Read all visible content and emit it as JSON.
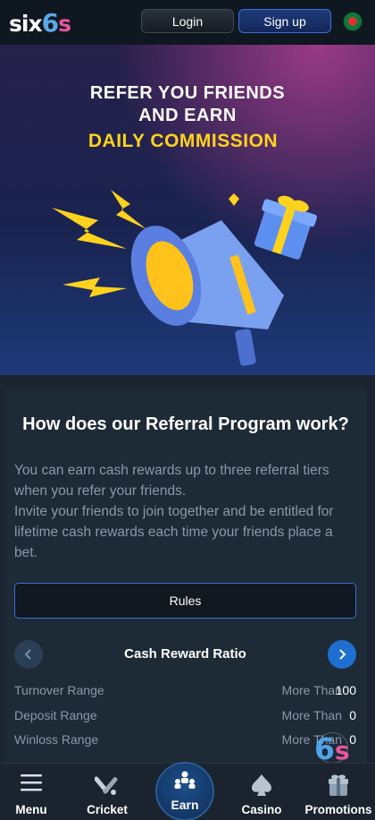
{
  "header": {
    "logo_part1": "six",
    "logo_part2": "6",
    "logo_part3": "s",
    "login_label": "Login",
    "signup_label": "Sign up",
    "flag_icon": "bangladesh-flag-icon"
  },
  "banner": {
    "line1": "REFER YOU FRIENDS",
    "line2": "AND EARN",
    "line3": "DAILY COMMISSION"
  },
  "referral": {
    "title": "How does our Referral Program work?",
    "description": "You can earn cash rewards up to three referral tiers when you refer your friends.\nInvite your friends to join together and be entitled for lifetime cash rewards each time your friends place a bet.",
    "rules_label": "Rules",
    "ratio_title": "Cash Reward Ratio",
    "rows": [
      {
        "label": "Turnover Range",
        "more_than": "More Than",
        "value": "100"
      },
      {
        "label": "Deposit Range",
        "more_than": "More Than",
        "value": "0"
      },
      {
        "label": "Winloss Range",
        "more_than": "More Than",
        "value": "0"
      }
    ]
  },
  "watermark": {
    "digit": "6",
    "letter": "s"
  },
  "nav": {
    "items": [
      {
        "label": "Menu",
        "icon": "menu-icon"
      },
      {
        "label": "Cricket",
        "icon": "cricket-icon"
      },
      {
        "label": "Earn",
        "icon": "earn-icon"
      },
      {
        "label": "Casino",
        "icon": "casino-icon"
      },
      {
        "label": "Promotions",
        "icon": "gift-icon"
      }
    ]
  },
  "colors": {
    "accent_blue": "#1f6fd0",
    "highlight_yellow": "#ffd21c",
    "background": "#1b2430"
  }
}
